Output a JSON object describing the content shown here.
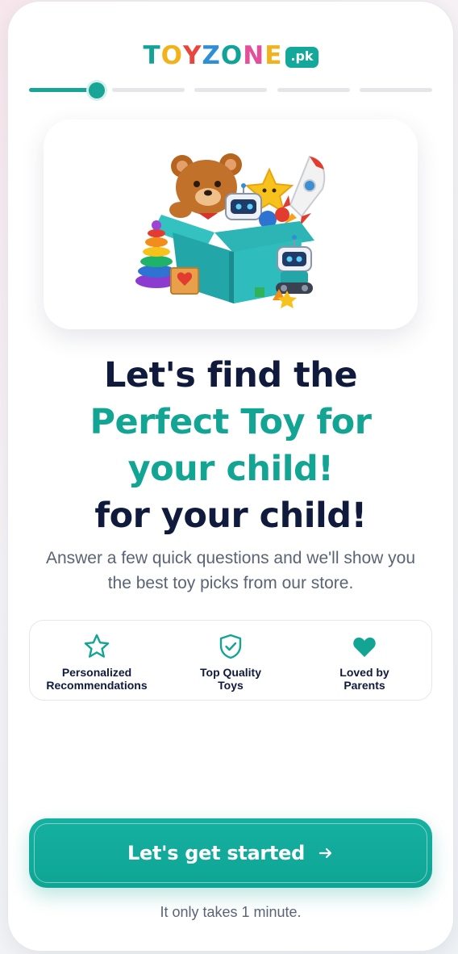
{
  "brand": {
    "letters": [
      {
        "char": "T",
        "color": "#13a396"
      },
      {
        "char": "O",
        "color": "#f2b21b"
      },
      {
        "char": "Y",
        "color": "#e8453c"
      },
      {
        "char": "Z",
        "color": "#2e8fd6"
      },
      {
        "char": "O",
        "color": "#13a396"
      },
      {
        "char": "N",
        "color": "#e44f9b"
      },
      {
        "char": "E",
        "color": "#f2b21b"
      }
    ],
    "tld": ".pk",
    "accent": "#12a593",
    "dark": "#0f1a3c"
  },
  "progress": {
    "total_steps": 5,
    "current_step": 1,
    "step_fill": 0.85
  },
  "hero": {
    "image": "toy-box-illustration"
  },
  "headline": {
    "line1": "Let's find the",
    "line2": "Perfect Toy for",
    "line3": "your child!",
    "line4": "for your child!"
  },
  "subtitle": "Answer a few quick questions and we'll show you the best toy picks from our store.",
  "features": [
    {
      "icon": "star-icon",
      "label": "Personalized\nRecommendations"
    },
    {
      "icon": "shield-check-icon",
      "label": "Top Quality\nToys"
    },
    {
      "icon": "heart-icon",
      "label": "Loved by\nParents"
    }
  ],
  "cta": {
    "label": "Let's get started",
    "icon": "arrow-right-icon"
  },
  "footnote": "It only takes 1 minute."
}
